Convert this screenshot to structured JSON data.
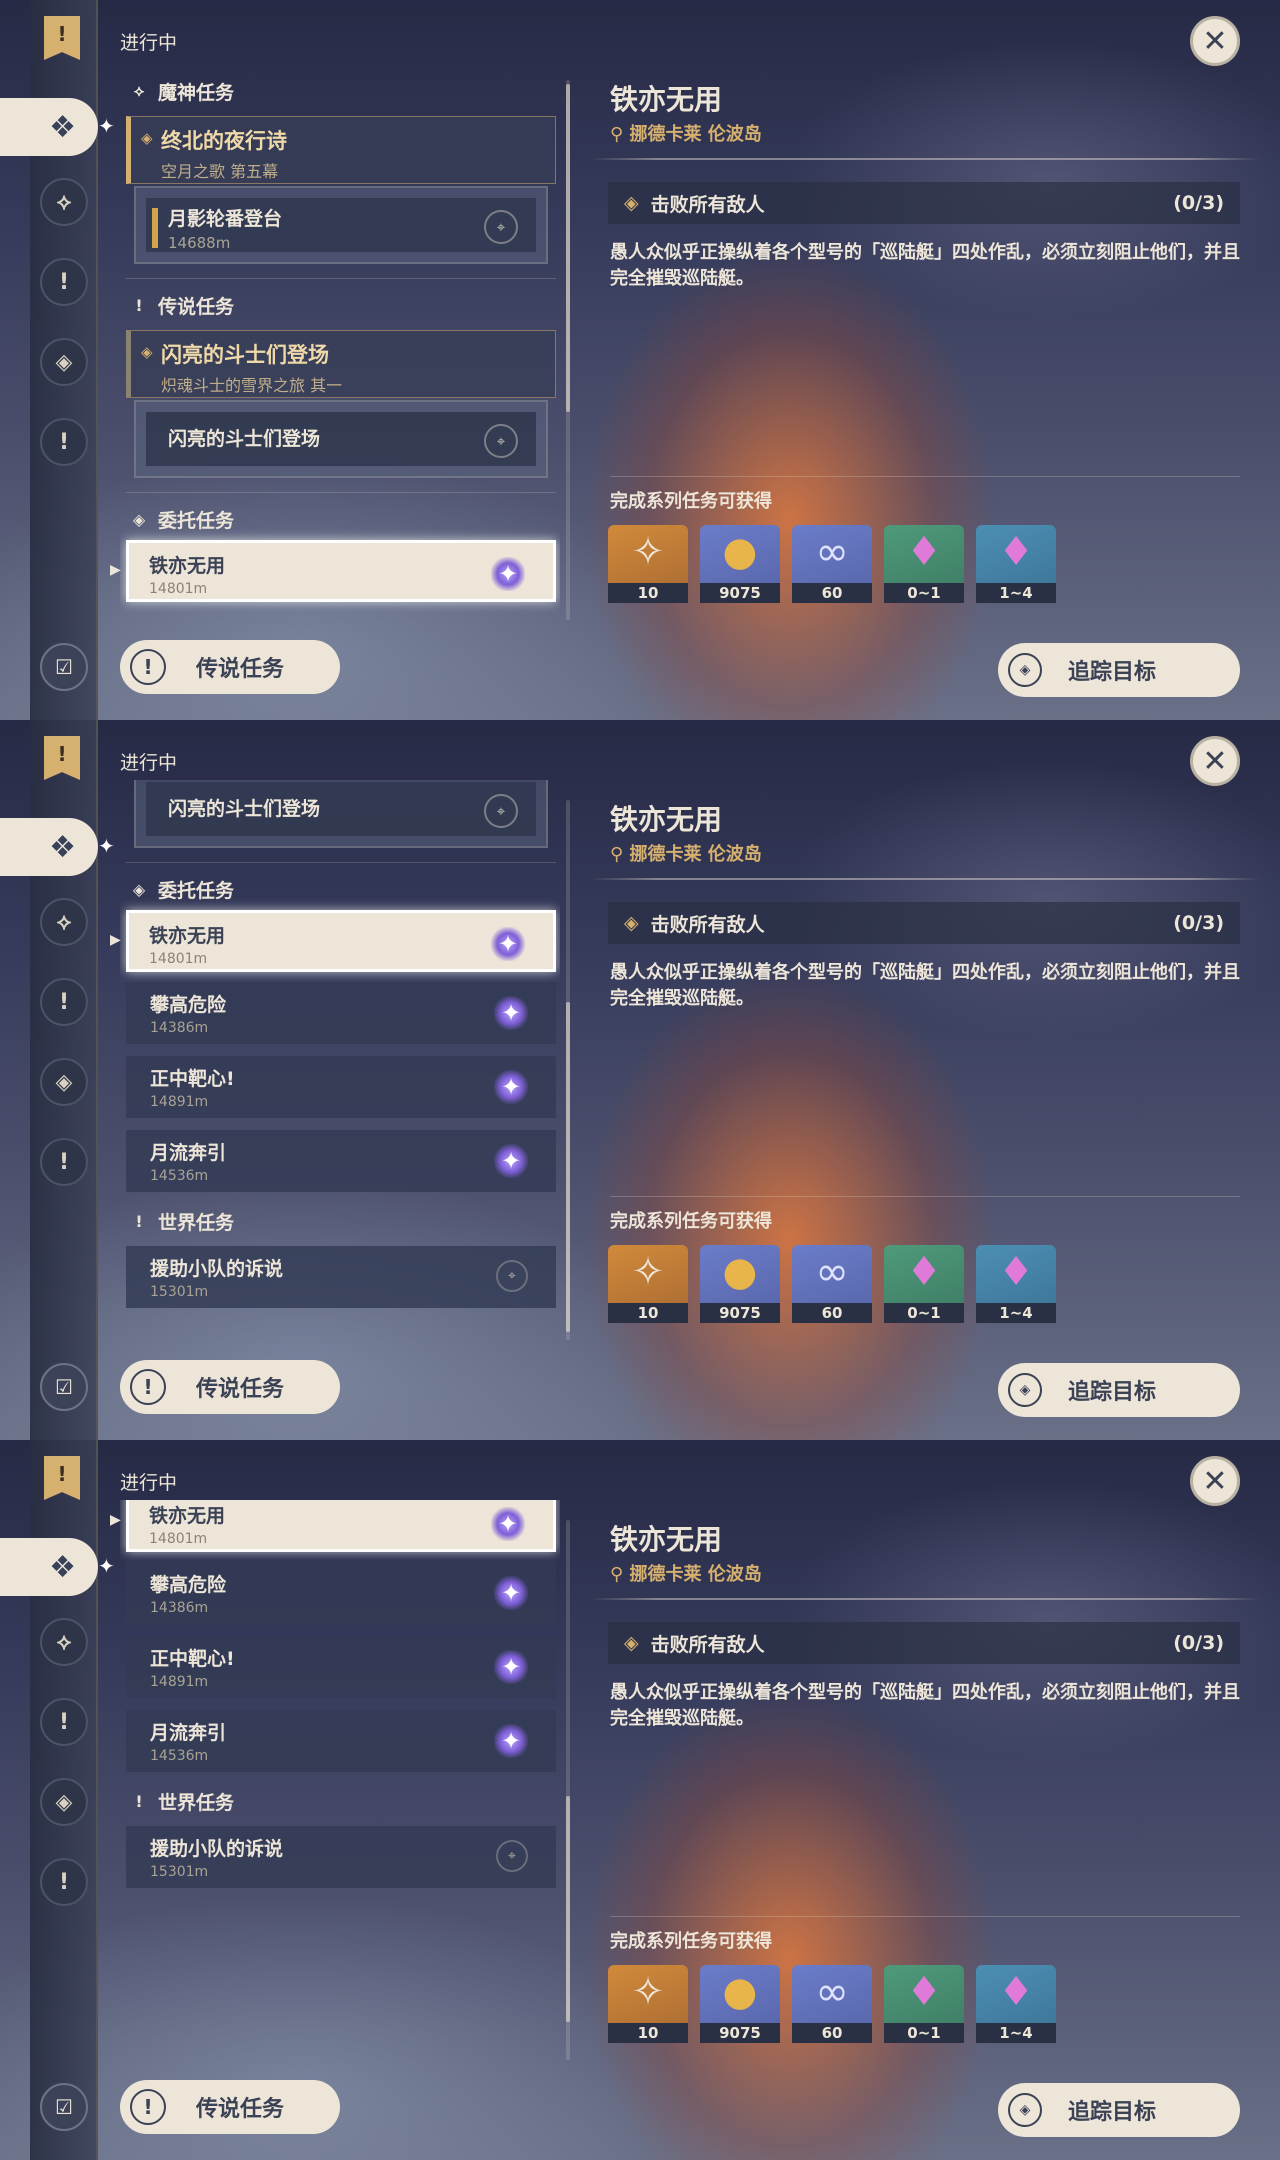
{
  "screens": [
    {
      "status_label": "进行中",
      "list": {
        "archon_section": "魔神任务",
        "archon_parent_title": "终北的夜行诗",
        "archon_parent_sub": "空月之歌 第五幕",
        "archon_sub_title": "月影轮番登台",
        "archon_sub_dist": "14688m",
        "legend_section": "传说任务",
        "legend_parent_title": "闪亮的斗士们登场",
        "legend_parent_sub": "炽魂斗士的雪界之旅 其一",
        "legend_sub_title": "闪亮的斗士们登场",
        "commission_section": "委托任务",
        "commission_items": [
          {
            "title": "铁亦无用",
            "dist": "14801m",
            "selected": true
          }
        ]
      }
    },
    {
      "status_label": "进行中",
      "list": {
        "legend_sub_title": "闪亮的斗士们登场",
        "commission_section": "委托任务",
        "commission_items": [
          {
            "title": "铁亦无用",
            "dist": "14801m",
            "selected": true
          },
          {
            "title": "攀高危险",
            "dist": "14386m"
          },
          {
            "title": "正中靶心!",
            "dist": "14891m"
          },
          {
            "title": "月流奔引",
            "dist": "14536m"
          }
        ],
        "world_section": "世界任务",
        "world_items": [
          {
            "title": "援助小队的诉说",
            "dist": "15301m"
          }
        ]
      }
    },
    {
      "status_label": "进行中",
      "list": {
        "commission_items": [
          {
            "title": "铁亦无用",
            "dist": "14801m",
            "selected": true
          },
          {
            "title": "攀高危险",
            "dist": "14386m"
          },
          {
            "title": "正中靶心!",
            "dist": "14891m"
          },
          {
            "title": "月流奔引",
            "dist": "14536m"
          }
        ],
        "world_section": "世界任务",
        "world_items": [
          {
            "title": "援助小队的诉说",
            "dist": "15301m"
          }
        ]
      }
    }
  ],
  "detail": {
    "title": "铁亦无用",
    "location": "挪德卡莱 伦波岛",
    "objective": "击败所有敌人",
    "objective_count": "(0/3)",
    "description": "愚人众似乎正操纵着各个型号的「巡陆艇」四处作乱，必须立刻阻止他们，并且完全摧毁巡陆艇。",
    "rewards_label": "完成系列任务可获得",
    "rewards": [
      {
        "icon": "primogem-icon",
        "count": "10",
        "color": "#d18a3a"
      },
      {
        "icon": "mora-icon",
        "count": "9075",
        "color": "#6b7cc9"
      },
      {
        "icon": "exp-icon",
        "count": "60",
        "color": "#6b7cc9"
      },
      {
        "icon": "crystal-icon",
        "count": "0~1",
        "color": "#4f9a7b"
      },
      {
        "icon": "crystal-cluster-icon",
        "count": "1~4",
        "color": "#4c8fb3"
      }
    ]
  },
  "buttons": {
    "legend_quests": "传说任务",
    "track_target": "追踪目标"
  },
  "colors": {
    "accent_gold": "#d6b06e",
    "cream": "#ece5d8",
    "panel_dark": "#323a54"
  }
}
